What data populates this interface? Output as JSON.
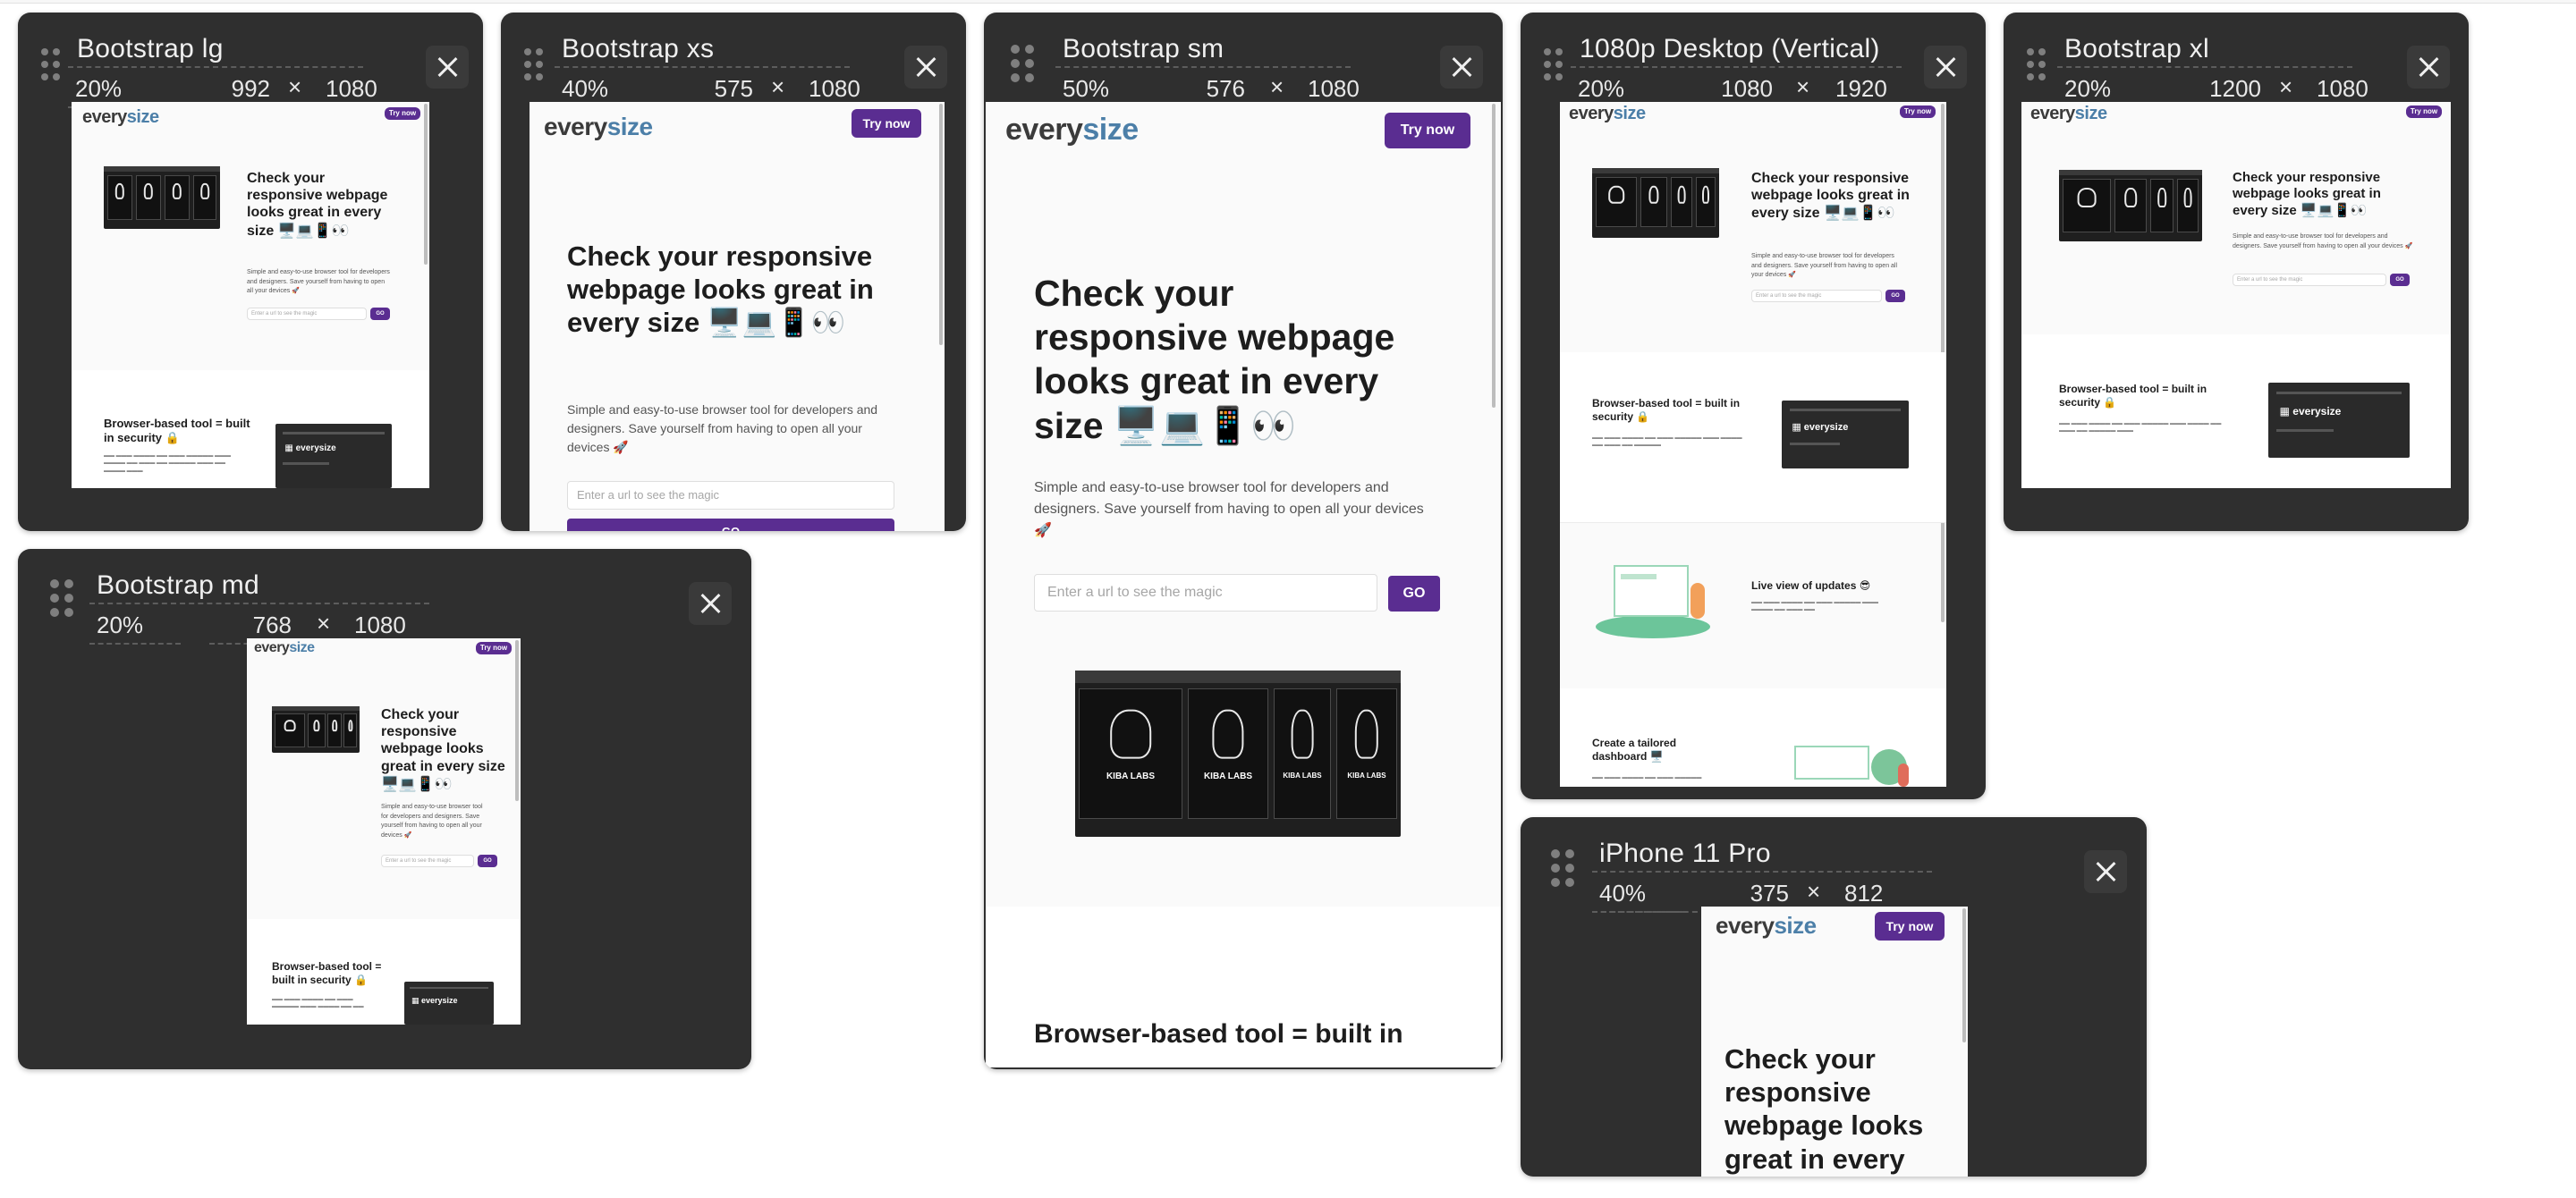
{
  "brand": {
    "every": "every",
    "size": "size",
    "accent": "#5a2d91",
    "logo_blue": "#4c7fa8"
  },
  "site": {
    "try_now": "Try now",
    "hero_title": "Check your responsive webpage looks great in every size",
    "hero_emoji": "🖥️💻📱👀",
    "hero_lead": "Simple and easy-to-use browser tool for developers and designers. Save yourself from having to open all your devices 🚀",
    "url_placeholder": "Enter a url to see the magic",
    "go": "GO",
    "mock_label": "KIBA LABS",
    "section1_title": "Browser-based tool = built in security 🔒",
    "section1_title_short": "Browser-based tool = built in",
    "section2_title": "Live view of updates 😎",
    "section3_title": "Create a tailored dashboard 🖥️"
  },
  "panels": [
    {
      "id": "bootstrap-lg",
      "title": "Bootstrap lg",
      "zoom": "20%",
      "width": "992",
      "x": "×",
      "height": "1080"
    },
    {
      "id": "bootstrap-xs",
      "title": "Bootstrap xs",
      "zoom": "40%",
      "width": "575",
      "x": "×",
      "height": "1080"
    },
    {
      "id": "bootstrap-sm",
      "title": "Bootstrap sm",
      "zoom": "50%",
      "width": "576",
      "x": "×",
      "height": "1080"
    },
    {
      "id": "desktop-1080p-vertical",
      "title": "1080p Desktop (Vertical)",
      "zoom": "20%",
      "width": "1080",
      "x": "×",
      "height": "1920"
    },
    {
      "id": "bootstrap-xl",
      "title": "Bootstrap xl",
      "zoom": "20%",
      "width": "1200",
      "x": "×",
      "height": "1080"
    },
    {
      "id": "bootstrap-md",
      "title": "Bootstrap md",
      "zoom": "20%",
      "width": "768",
      "x": "×",
      "height": "1080"
    },
    {
      "id": "iphone-11-pro",
      "title": "iPhone 11 Pro",
      "zoom": "40%",
      "width": "375",
      "x": "×",
      "height": "812"
    }
  ],
  "icons": {
    "drag": "drag-handle-icon",
    "close": "close-icon"
  }
}
